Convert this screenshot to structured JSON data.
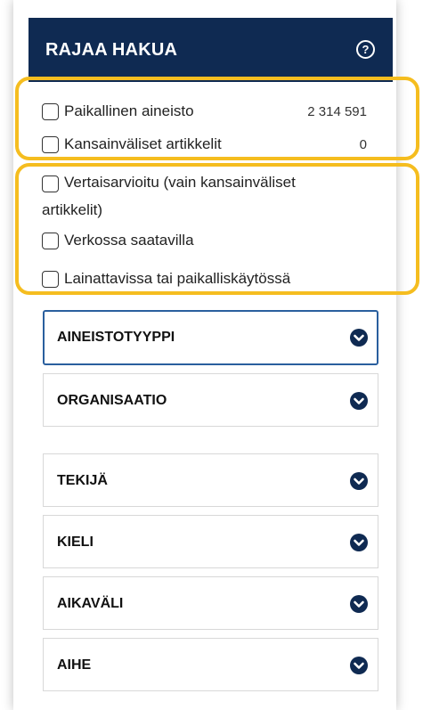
{
  "header": {
    "title": "RAJAA HAKUA",
    "help_glyph": "?"
  },
  "filters": {
    "group1": [
      {
        "label": "Paikallinen aineisto",
        "count": "2 314 591",
        "checked": false
      },
      {
        "label": "Kansainväliset artikkelit",
        "count": "0",
        "checked": false
      }
    ],
    "group2": [
      {
        "label_line1": "Vertaisarvioitu (vain kansainväliset",
        "label_line2": "artikkelit)",
        "checked": false
      },
      {
        "label": "Verkossa saatavilla",
        "checked": false
      },
      {
        "label": "Lainattavissa tai paikalliskäytössä",
        "checked": false
      }
    ]
  },
  "facets": [
    {
      "label": "AINEISTOTYYPPI",
      "expanded": false,
      "focused": true
    },
    {
      "label": "ORGANISAATIO",
      "expanded": false
    },
    {
      "label": "TEKIJÄ",
      "expanded": false
    },
    {
      "label": "KIELI",
      "expanded": false
    },
    {
      "label": "AIKAVÄLI",
      "expanded": false
    },
    {
      "label": "AIHE",
      "expanded": false
    }
  ],
  "colors": {
    "header_bg": "#0f2a52",
    "highlight_outline": "#f5bd1f",
    "focus_border": "#2a5f9e"
  },
  "icons": {
    "help": "question-circle-icon",
    "facet_toggle": "chevron-down-circle-icon"
  }
}
